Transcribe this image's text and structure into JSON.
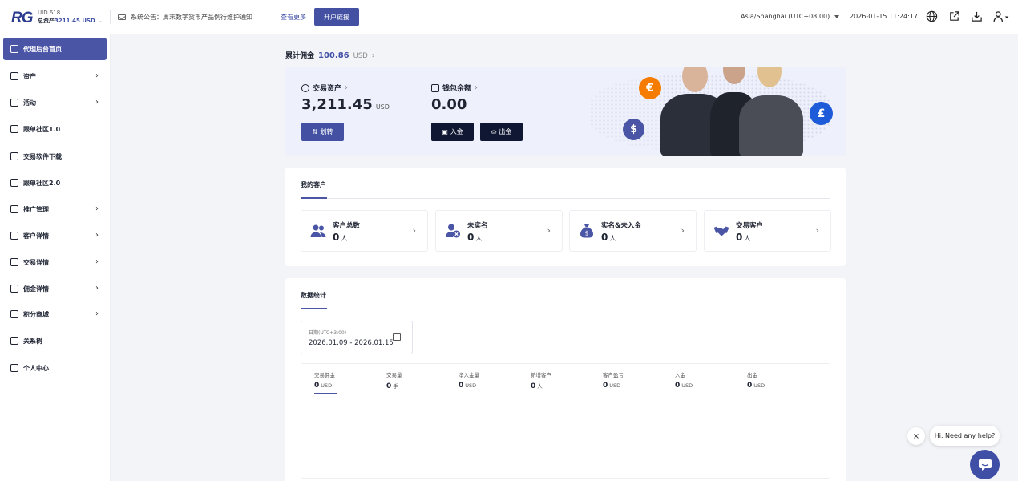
{
  "header": {
    "logo": "RG",
    "uid": "UID 618",
    "assets_label": "总资产",
    "assets_value": "3211.45 USD",
    "notice": "系统公告：周末数字货币产品例行维护通知",
    "view_more": "查看更多",
    "open_link": "开户链接",
    "timezone": "Asia/Shanghai (UTC+08:00)",
    "datetime": "2026-01-15 11:24:17"
  },
  "sidebar": {
    "items": [
      {
        "label": "代理后台首页",
        "icon": "home-icon",
        "has_children": false,
        "active": true
      },
      {
        "label": "资产",
        "icon": "database-icon",
        "has_children": true
      },
      {
        "label": "活动",
        "icon": "bookmark-icon",
        "has_children": true
      },
      {
        "label": "跟单社区1.0",
        "icon": "bank-icon",
        "has_children": false
      },
      {
        "label": "交易软件下载",
        "icon": "download-icon",
        "has_children": false
      },
      {
        "label": "跟单社区2.0",
        "icon": "bank-icon",
        "has_children": false
      },
      {
        "label": "推广管理",
        "icon": "share-icon",
        "has_children": true
      },
      {
        "label": "客户详情",
        "icon": "user-card-icon",
        "has_children": true
      },
      {
        "label": "交易详情",
        "icon": "document-icon",
        "has_children": true
      },
      {
        "label": "佣金详情",
        "icon": "bank-icon",
        "has_children": true
      },
      {
        "label": "积分商城",
        "icon": "coins-icon",
        "has_children": true
      },
      {
        "label": "关系树",
        "icon": "tree-icon",
        "has_children": false
      },
      {
        "label": "个人中心",
        "icon": "profile-icon",
        "has_children": false
      }
    ]
  },
  "commission": {
    "label": "累计佣金",
    "value": "100.86",
    "unit": "USD"
  },
  "banner": {
    "trading_assets_label": "交易资产",
    "trading_assets_value": "3,211.45",
    "trading_assets_unit": "USD",
    "transfer_button": "划转",
    "wallet_label": "钱包余额",
    "wallet_value": "0.00",
    "deposit_button": "入金",
    "withdraw_button": "出金",
    "coin_euro": "€",
    "coin_dollar": "$",
    "coin_pound": "£"
  },
  "customers": {
    "title": "我的客户",
    "cards": [
      {
        "label": "客户总数",
        "value": "0",
        "unit": "人",
        "icon": "users-icon"
      },
      {
        "label": "未实名",
        "value": "0",
        "unit": "人",
        "icon": "user-x-icon"
      },
      {
        "label": "实名&未入金",
        "value": "0",
        "unit": "人",
        "icon": "money-bag-icon"
      },
      {
        "label": "交易客户",
        "value": "0",
        "unit": "人",
        "icon": "handshake-icon"
      }
    ]
  },
  "stats": {
    "title": "数据统计",
    "date_label": "日期(UTC+3:00)",
    "date_range": "2026.01.09 - 2026.01.15",
    "metrics": [
      {
        "label": "交易佣金",
        "value": "0",
        "unit": "USD"
      },
      {
        "label": "交易量",
        "value": "0",
        "unit": "手"
      },
      {
        "label": "净入金量",
        "value": "0",
        "unit": "USD"
      },
      {
        "label": "新增客户",
        "value": "0",
        "unit": "人"
      },
      {
        "label": "客户盈亏",
        "value": "0",
        "unit": "USD"
      },
      {
        "label": "入金",
        "value": "0",
        "unit": "USD"
      },
      {
        "label": "出金",
        "value": "0",
        "unit": "USD"
      }
    ]
  },
  "chat": {
    "close": "×",
    "bubble": "Hi. Need any help?"
  },
  "colors": {
    "accent": "#4a55a6",
    "navy": "#101733",
    "euro_coin": "#f57c00",
    "dollar_coin": "#4a55a6",
    "pound_coin": "#1e5bd8"
  }
}
